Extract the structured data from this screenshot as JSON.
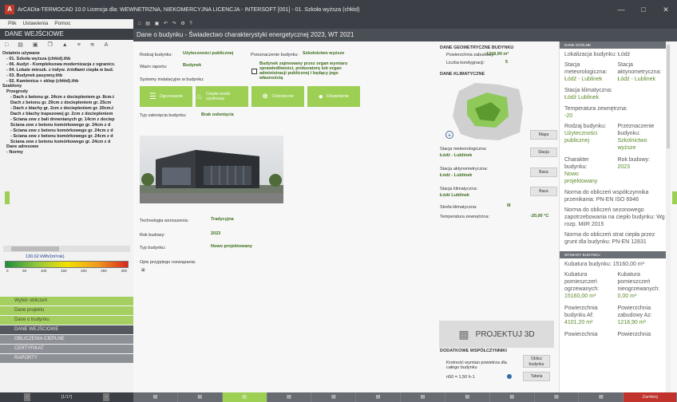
{
  "window": {
    "title": "ArCADia-TERMOCAD 10.0 Licencja dla: WEWNETRZNA, NIEKOMERCYJNA LICENCJA - INTERSOFT [001] - 01. Szkoła wyższa (chłód)",
    "app_icon": "arcadia-logo"
  },
  "menu": {
    "items": [
      "Plik",
      "Ustawienia",
      "Pomoc"
    ]
  },
  "left_panel": {
    "title": "DANE WEJŚCIOWE",
    "tree": [
      {
        "text": "Ostatnio używane",
        "bold": true,
        "indent": 0
      },
      {
        "text": "- 01. Szkoła wyższa (chłód).thb",
        "bold": true,
        "indent": 1
      },
      {
        "text": "- 06. Audyt - Kompleksowa modernizacja z ogranicz.",
        "bold": true,
        "indent": 1
      },
      {
        "text": "- 04. Lokale mieszk. z indyw. źródłami ciepła w bud.",
        "bold": true,
        "indent": 1
      },
      {
        "text": "- 03. Budynek pasywny.thb",
        "bold": true,
        "indent": 1
      },
      {
        "text": "- 02. Kamienica + sklep (chłód).thb",
        "bold": true,
        "indent": 1
      },
      {
        "text": "Szablony",
        "bold": true,
        "indent": 0
      },
      {
        "text": "Przegrody",
        "bold": true,
        "indent": 1
      },
      {
        "text": "- Dach z betonu gr. 24cm z dociepleniem gr. 8cm.t",
        "bold": true,
        "indent": 2
      },
      {
        "text": "Dach z betonu gr. 29cm z dociepleniem gr. 25cm",
        "bold": true,
        "indent": 2
      },
      {
        "text": "- Dach z blachy gr. 2cm z dociepleniem gr. 20cm.t",
        "bold": true,
        "indent": 2
      },
      {
        "text": "Dach z blachy trapezowej gr. 2cm z dociepleniem",
        "bold": true,
        "indent": 2
      },
      {
        "text": "- Ściana zew z bali drewnianych gr. 14cm z dociep",
        "bold": true,
        "indent": 2
      },
      {
        "text": "Ściana zew z betonu komórkowego gr. 24cm z d",
        "bold": true,
        "indent": 2
      },
      {
        "text": "- Ściana zew z betonu komórkowego gr. 24cm z d",
        "bold": true,
        "indent": 2
      },
      {
        "text": "- Ściana zew z betonu komórkowego gr. 24cm z d",
        "bold": true,
        "indent": 2
      },
      {
        "text": "Ściana zew z betonu komórkowego gr. 24cm z d",
        "bold": true,
        "indent": 2
      },
      {
        "text": "Dane adresowe",
        "bold": true,
        "indent": 1
      },
      {
        "text": "- Normy",
        "bold": true,
        "indent": 1
      }
    ],
    "energy": {
      "value_label": "130,62 kWh/(m²rok)",
      "ticks": [
        "0",
        "50",
        "100",
        "150",
        "200",
        "250",
        "300"
      ]
    },
    "nav": [
      {
        "label": "Wybór obliczeń",
        "style": "green"
      },
      {
        "label": "Dane projektu",
        "style": "green"
      },
      {
        "label": "Dane o budynku",
        "style": "green"
      },
      {
        "label": "DANE WEJŚCIOWE",
        "style": "dark"
      },
      {
        "label": "OBLICZENIA CIEPLNE",
        "style": "gray"
      },
      {
        "label": "CERTYFIKAT",
        "style": "gray"
      },
      {
        "label": "RAPORTY",
        "style": "gray"
      }
    ],
    "pager": {
      "label": "[1/17]"
    }
  },
  "main": {
    "header": "Dane o budynku - Świadectwo charakterystyki energetycznej 2023, WT 2021",
    "rodzaj_label": "Rodzaj budynku:",
    "rodzaj_value": "Użyteczności publicznej",
    "wazn_label": "Ważn raportu:",
    "wazn_value": "Budynek",
    "systemy_label": "Systemy instalacyjne w budynku:",
    "przezn_label": "Przeznaczenie budynku:",
    "przezn_value": "Szkolnictwo wyższe",
    "checkbox_text": "Budynek zajmowany przez organ wymiaru sprawiedliwości, prokuratorę lub organ administracji publicznej i będący jego własnością",
    "tiles": [
      {
        "label": "Ogrzewanie",
        "icon": "radiator-icon"
      },
      {
        "label": "Ciepła woda użytkowa",
        "icon": "tap-icon"
      },
      {
        "label": "Chłodzenie",
        "icon": "snowflake-icon"
      },
      {
        "label": "Oświetlenie",
        "icon": "bulb-icon"
      }
    ],
    "oslona_label": "Typ osłonięcia budynku:",
    "oslona_value": "Brak osłonięcia",
    "techn_label": "Technologia wznoszenia:",
    "techn_value": "Tradycyjna",
    "rok_label": "Rok budowy:",
    "rok_value": "2023",
    "typ_label": "Typ budynku:",
    "typ_value": "Nowo projektowany",
    "opis_label": "Opis przyjętego rozwiązania:",
    "opis_value": "⊞",
    "geom_title": "DANE GEOMETRYCZNE BUDYNKU",
    "pow_label": "Powierzchnia zabudowy:",
    "pow_value": "1218,90 m²",
    "kond_label": "Liczba kondygnacji:",
    "kond_value": "5",
    "klim_title": "DANE KLIMATYCZNE",
    "mapa_btn": "Mapa",
    "stac_met_label": "Stacja meteorologiczna:",
    "stac_met_value": "Łódź - Lublinek",
    "stac_met_btn": "Stacja",
    "stac_akt_label": "Stacja aktynometryczna:",
    "stac_akt_value": "Łódź - Lublinek",
    "stac_akt_btn": "Baza",
    "stac_kli_label": "Stacja klimatyczna:",
    "stac_kli_value": "Łódź Lublinek",
    "stac_kli_btn": "Baza",
    "strefa_label": "Strefa klimatyczna:",
    "strefa_value": "III",
    "temp_label": "Temperatura zewnętrzna:",
    "temp_value": "-20,00 °C",
    "projektuj": "PROJEKTUJ 3D",
    "dod_title": "DODATKOWE WSPÓŁCZYNNIKI",
    "krot_label": "Krotność wymian powietrza dla całego budynku",
    "krot_value": "n50 = 1,50 h-1",
    "obl_btn": "Oblicz budynku",
    "tabela_btn": "Tabela"
  },
  "right_panel": {
    "hdr1": "DANE OGÓLNE",
    "lokalizacja": "Lokalizacja budynku: Łódź",
    "stacja_met_k": "Stacja meteorologiczna:",
    "stacja_met_v": "Łódź - Lublinek",
    "stacja_akt_k": "Stacja aktynometryczna:",
    "stacja_akt_v": "Łódź - Lublinek",
    "stacja_kli_k": "Stacja klimatyczna:",
    "stacja_kli_v": "Łódź Lublinek",
    "temp_k": "Temperatura zewnętrzna:",
    "temp_v": "-20",
    "rodzaj_k": "Rodzaj budynku:",
    "rodzaj_v": "Użyteczności publicznej",
    "przezn_k": "Przeznaczenie budynku:",
    "przezn_v": "Szkolnictwo wyższe",
    "charakter_k": "Charakter budynku:",
    "charakter_v": "Nowo projektowany",
    "rok_k": "Rok budowy:",
    "rok_v": "2023",
    "norma1": "Norma do obliczeń współczynnika przenikania: PN-EN ISO 6946",
    "norma2": "Norma do obliczeń sezonowego zapotrzebowania na ciepło budynku: Wg rozp. MiIR 2015",
    "norma3": "Norma do obliczeń strat ciepła przez grunt dla budynku: PN-EN 12831",
    "hdr2": "WYMIARY BUDYNKU",
    "kubatura": "Kubatura budynku: 15160,00 m³",
    "kub_ogrz_k": "Kubatura pomieszczeń ogrzewanych:",
    "kub_ogrz_v": "15160,00 m³",
    "kub_nie_k": "Kubatura pomieszczeń nieogrzewanych:",
    "kub_nie_v": "0,00 m³",
    "pow_af_k": "Powierzchnia budynku Af:",
    "pow_af_v": "4101,20 m²",
    "pow_zab_k": "Powierzchnia zabudowy Az:",
    "pow_zab_v": "1218,90 m²",
    "pow1": "Powierzchnia",
    "pow2": "Powierzchnia"
  },
  "bottombar": {
    "zamknij": "Zamknij"
  }
}
